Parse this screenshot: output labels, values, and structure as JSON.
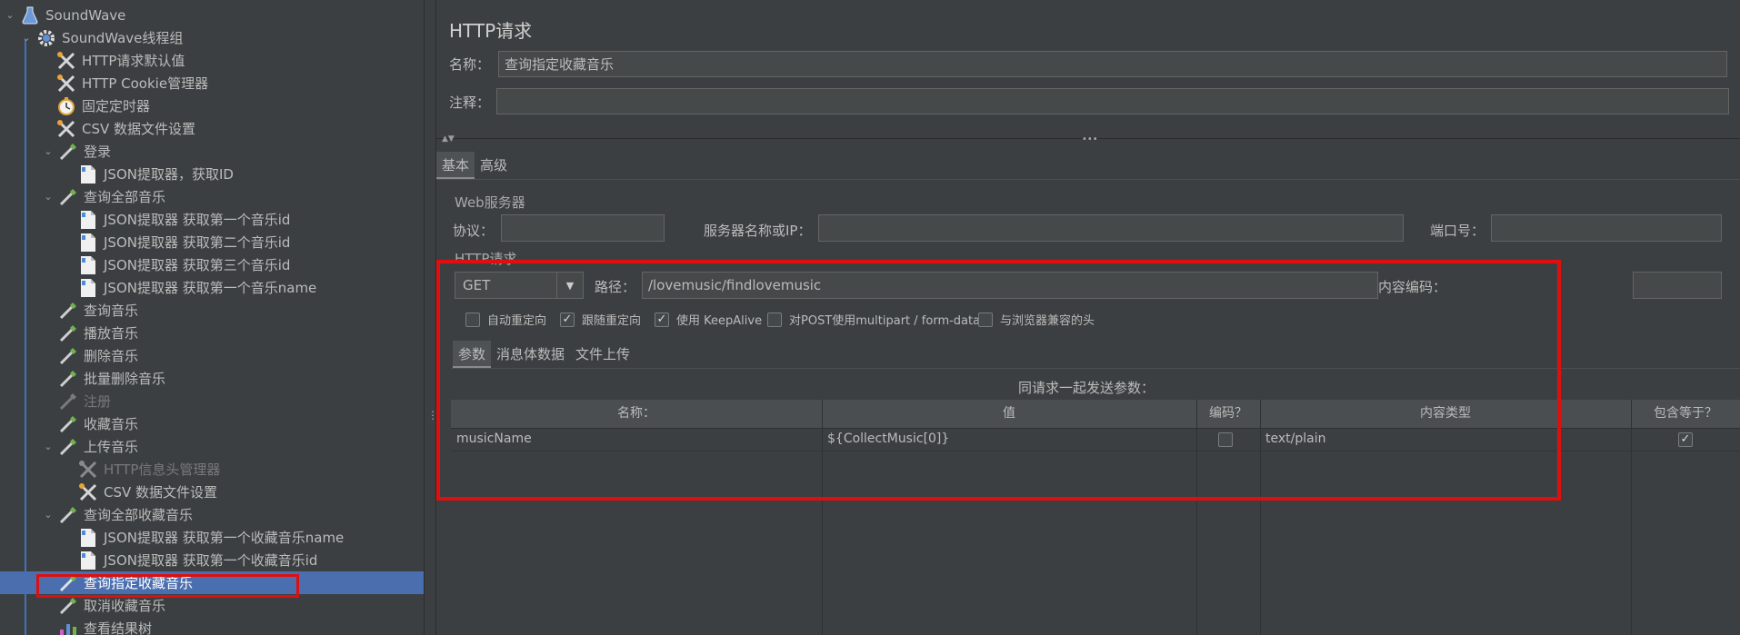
{
  "tree": {
    "items": [
      {
        "label": "SoundWave",
        "icon": "flask-icon",
        "toggle": "expanded"
      },
      {
        "label": "SoundWave线程组",
        "icon": "gear-icon",
        "toggle": "expanded"
      },
      {
        "label": "HTTP请求默认值",
        "icon": "wrench-icon",
        "toggle": ""
      },
      {
        "label": "HTTP Cookie管理器",
        "icon": "wrench-icon",
        "toggle": ""
      },
      {
        "label": "固定定时器",
        "icon": "stopwatch-icon",
        "toggle": ""
      },
      {
        "label": "CSV 数据文件设置",
        "icon": "wrench-icon",
        "toggle": ""
      },
      {
        "label": "登录",
        "icon": "pipette-icon",
        "toggle": "expanded"
      },
      {
        "label": "JSON提取器，获取ID",
        "icon": "document-icon",
        "toggle": ""
      },
      {
        "label": "查询全部音乐",
        "icon": "pipette-icon",
        "toggle": "expanded"
      },
      {
        "label": "JSON提取器 获取第一个音乐id",
        "icon": "document-icon",
        "toggle": ""
      },
      {
        "label": "JSON提取器 获取第二个音乐id",
        "icon": "document-icon",
        "toggle": ""
      },
      {
        "label": "JSON提取器 获取第三个音乐id",
        "icon": "document-icon",
        "toggle": ""
      },
      {
        "label": "JSON提取器 获取第一个音乐name",
        "icon": "document-icon",
        "toggle": ""
      },
      {
        "label": "查询音乐",
        "icon": "pipette-icon",
        "toggle": ""
      },
      {
        "label": "播放音乐",
        "icon": "pipette-icon",
        "toggle": ""
      },
      {
        "label": "删除音乐",
        "icon": "pipette-icon",
        "toggle": ""
      },
      {
        "label": "批量删除音乐",
        "icon": "pipette-icon",
        "toggle": ""
      },
      {
        "label": "注册",
        "icon": "pipette-icon",
        "toggle": "",
        "disabled": true
      },
      {
        "label": "收藏音乐",
        "icon": "pipette-icon",
        "toggle": ""
      },
      {
        "label": "上传音乐",
        "icon": "pipette-icon",
        "toggle": "expanded"
      },
      {
        "label": "HTTP信息头管理器",
        "icon": "wrench-icon",
        "toggle": "",
        "disabled": true
      },
      {
        "label": "CSV 数据文件设置",
        "icon": "wrench-icon",
        "toggle": ""
      },
      {
        "label": "查询全部收藏音乐",
        "icon": "pipette-icon",
        "toggle": "expanded"
      },
      {
        "label": "JSON提取器 获取第一个收藏音乐name",
        "icon": "document-icon",
        "toggle": ""
      },
      {
        "label": "JSON提取器 获取第一个收藏音乐id",
        "icon": "document-icon",
        "toggle": ""
      },
      {
        "label": "查询指定收藏音乐",
        "icon": "pipette-icon",
        "toggle": "",
        "selected": true
      },
      {
        "label": "取消收藏音乐",
        "icon": "pipette-icon",
        "toggle": ""
      },
      {
        "label": "查看结果树",
        "icon": "chart-icon",
        "toggle": ""
      }
    ]
  },
  "panel": {
    "title": "HTTP请求",
    "name_label": "名称：",
    "name_value": "查询指定收藏音乐",
    "comment_label": "注释：",
    "comment_value": "",
    "tabs": [
      "基本",
      "高级"
    ],
    "web_server": {
      "title": "Web服务器",
      "protocol_label": "协议：",
      "protocol_value": "",
      "server_label": "服务器名称或IP：",
      "server_value": "",
      "port_label": "端口号：",
      "port_value": ""
    },
    "http_request": {
      "title": "HTTP请求",
      "method": "GET",
      "path_label": "路径：",
      "path_value": "/lovemusic/findlovemusic",
      "encoding_label": "内容编码：",
      "encoding_value": "",
      "options": [
        {
          "label": "自动重定向",
          "checked": false
        },
        {
          "label": "跟随重定向",
          "checked": true
        },
        {
          "label": "使用 KeepAlive",
          "checked": true
        },
        {
          "label": "对POST使用multipart / form-data",
          "checked": false
        },
        {
          "label": "与浏览器兼容的头",
          "checked": false
        }
      ],
      "subtabs": [
        "参数",
        "消息体数据",
        "文件上传"
      ],
      "params_caption": "同请求一起发送参数：",
      "columns": [
        "名称：",
        "值",
        "编码？",
        "内容类型",
        "包含等于？"
      ],
      "rows": [
        {
          "name": "musicName",
          "value": "${CollectMusic[0]}",
          "encode": false,
          "content_type": "text/plain",
          "include_equals": true
        }
      ]
    }
  },
  "colors": {
    "accent": "#4b6eaf",
    "highlight": "#e00f0f",
    "background": "#3c3f41"
  }
}
